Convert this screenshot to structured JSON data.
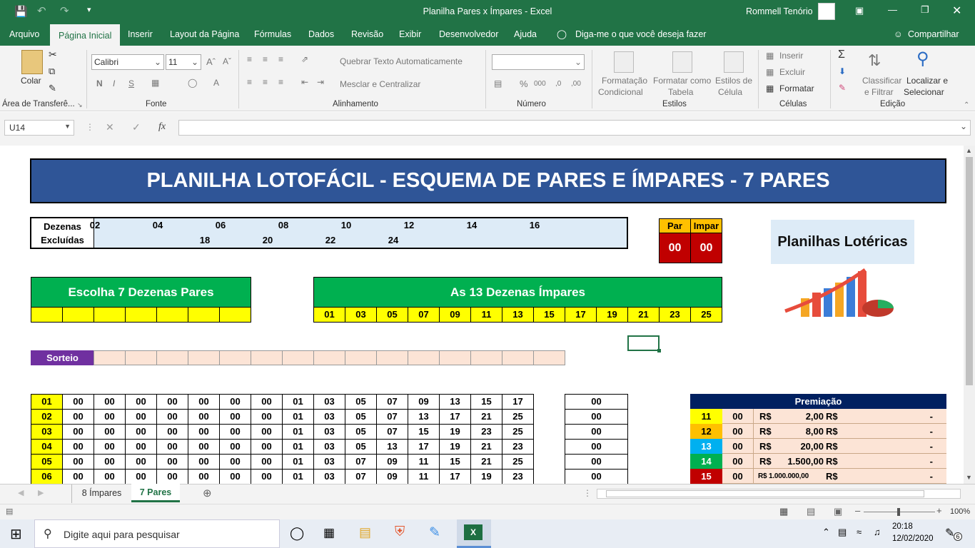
{
  "window": {
    "title": "Planilha Pares x Ímpares  -  Excel",
    "user": "Rommell Tenório"
  },
  "menu": [
    "Arquivo",
    "Página Inicial",
    "Inserir",
    "Layout da Página",
    "Fórmulas",
    "Dados",
    "Revisão",
    "Exibir",
    "Desenvolvedor",
    "Ajuda"
  ],
  "tell_me": "Diga-me o que você deseja fazer",
  "share": "Compartilhar",
  "ribbon": {
    "paste": "Colar",
    "clipboard": "Área de Transferê...",
    "font_name": "Calibri",
    "font_size": "11",
    "bold": "N",
    "italic": "I",
    "underline": "S",
    "font_group": "Fonte",
    "wrap_text": "Quebrar Texto Automaticamente",
    "merge_center": "Mesclar e Centralizar",
    "align_group": "Alinhamento",
    "number_format": "",
    "percent": "%",
    "thousands": "000",
    "dec_inc": ",0",
    "dec_dec": ",00",
    "number_group": "Número",
    "cond_format_1": "Formatação",
    "cond_format_2": "Condicional",
    "format_table_1": "Formatar como",
    "format_table_2": "Tabela",
    "cell_styles_1": "Estilos de",
    "cell_styles_2": "Célula",
    "styles_group": "Estilos",
    "insert": "Inserir",
    "delete": "Excluir",
    "format": "Formatar",
    "cells_group": "Células",
    "sort_1": "Classificar",
    "sort_2": "e Filtrar",
    "find_1": "Localizar e",
    "find_2": "Selecionar",
    "edit_group": "Edição"
  },
  "formula_bar": {
    "name_box": "U14",
    "fx": "fx",
    "content": ""
  },
  "sheet": {
    "title": "PLANILHA LOTOFÁCIL - ESQUEMA DE PARES E ÍMPARES - 7 PARES",
    "excluded_label_1": "Dezenas",
    "excluded_label_2": "Excluídas",
    "excluded_row1": [
      "02",
      "04",
      "06",
      "08",
      "10",
      "12",
      "14",
      "16"
    ],
    "excluded_row2": [
      "18",
      "20",
      "22",
      "24"
    ],
    "par_label": "Par",
    "impar_label": "Impar",
    "par_value": "00",
    "impar_value": "00",
    "brand": "Planilhas Lotéricas",
    "choose_header": "Escolha 7 Dezenas Pares",
    "odd_header": "As 13 Dezenas Ímpares",
    "odd_numbers": [
      "01",
      "03",
      "05",
      "07",
      "09",
      "11",
      "13",
      "15",
      "17",
      "19",
      "21",
      "23",
      "25"
    ],
    "draw_label": "Sorteio",
    "games": [
      {
        "n": "01",
        "nums": [
          "00",
          "00",
          "00",
          "00",
          "00",
          "00",
          "00",
          "01",
          "03",
          "05",
          "07",
          "09",
          "13",
          "15",
          "17"
        ],
        "hits": "00"
      },
      {
        "n": "02",
        "nums": [
          "00",
          "00",
          "00",
          "00",
          "00",
          "00",
          "00",
          "01",
          "03",
          "05",
          "07",
          "13",
          "17",
          "21",
          "25"
        ],
        "hits": "00"
      },
      {
        "n": "03",
        "nums": [
          "00",
          "00",
          "00",
          "00",
          "00",
          "00",
          "00",
          "01",
          "03",
          "05",
          "07",
          "15",
          "19",
          "23",
          "25"
        ],
        "hits": "00"
      },
      {
        "n": "04",
        "nums": [
          "00",
          "00",
          "00",
          "00",
          "00",
          "00",
          "00",
          "01",
          "03",
          "05",
          "13",
          "17",
          "19",
          "21",
          "23"
        ],
        "hits": "00"
      },
      {
        "n": "05",
        "nums": [
          "00",
          "00",
          "00",
          "00",
          "00",
          "00",
          "00",
          "01",
          "03",
          "07",
          "09",
          "11",
          "15",
          "21",
          "25"
        ],
        "hits": "00"
      },
      {
        "n": "06",
        "nums": [
          "00",
          "00",
          "00",
          "00",
          "00",
          "00",
          "00",
          "01",
          "03",
          "07",
          "09",
          "11",
          "17",
          "19",
          "23"
        ],
        "hits": "00"
      }
    ],
    "prize_header": "Premiação",
    "prizes": [
      {
        "pts": "11",
        "count": "00",
        "cur": "R$",
        "value": "2,00",
        "cur2": "R$",
        "total": "-",
        "color": "#ffff00",
        "fg": "#000"
      },
      {
        "pts": "12",
        "count": "00",
        "cur": "R$",
        "value": "8,00",
        "cur2": "R$",
        "total": "-",
        "color": "#ffc000",
        "fg": "#000"
      },
      {
        "pts": "13",
        "count": "00",
        "cur": "R$",
        "value": "20,00",
        "cur2": "R$",
        "total": "-",
        "color": "#00b0f0",
        "fg": "#fff"
      },
      {
        "pts": "14",
        "count": "00",
        "cur": "R$",
        "value": "1.500,00",
        "cur2": "R$",
        "total": "-",
        "color": "#00b050",
        "fg": "#fff"
      },
      {
        "pts": "15",
        "count": "00",
        "cur": "R$",
        "value": "R$ 1.000.000,00",
        "cur2": "R$",
        "total": "-",
        "color": "#c00000",
        "fg": "#fff"
      }
    ]
  },
  "tabs": [
    "8 Ímpares",
    "7 Pares"
  ],
  "status": {
    "zoom": "100%"
  },
  "taskbar": {
    "search": "Digite aqui para pesquisar",
    "time": "20:18",
    "date": "12/02/2020",
    "notif": "6"
  },
  "colors": {
    "excel_green": "#217346",
    "title_blue": "#2f5597",
    "header_green": "#00b050",
    "red": "#c00000",
    "purple": "#7030a0"
  }
}
